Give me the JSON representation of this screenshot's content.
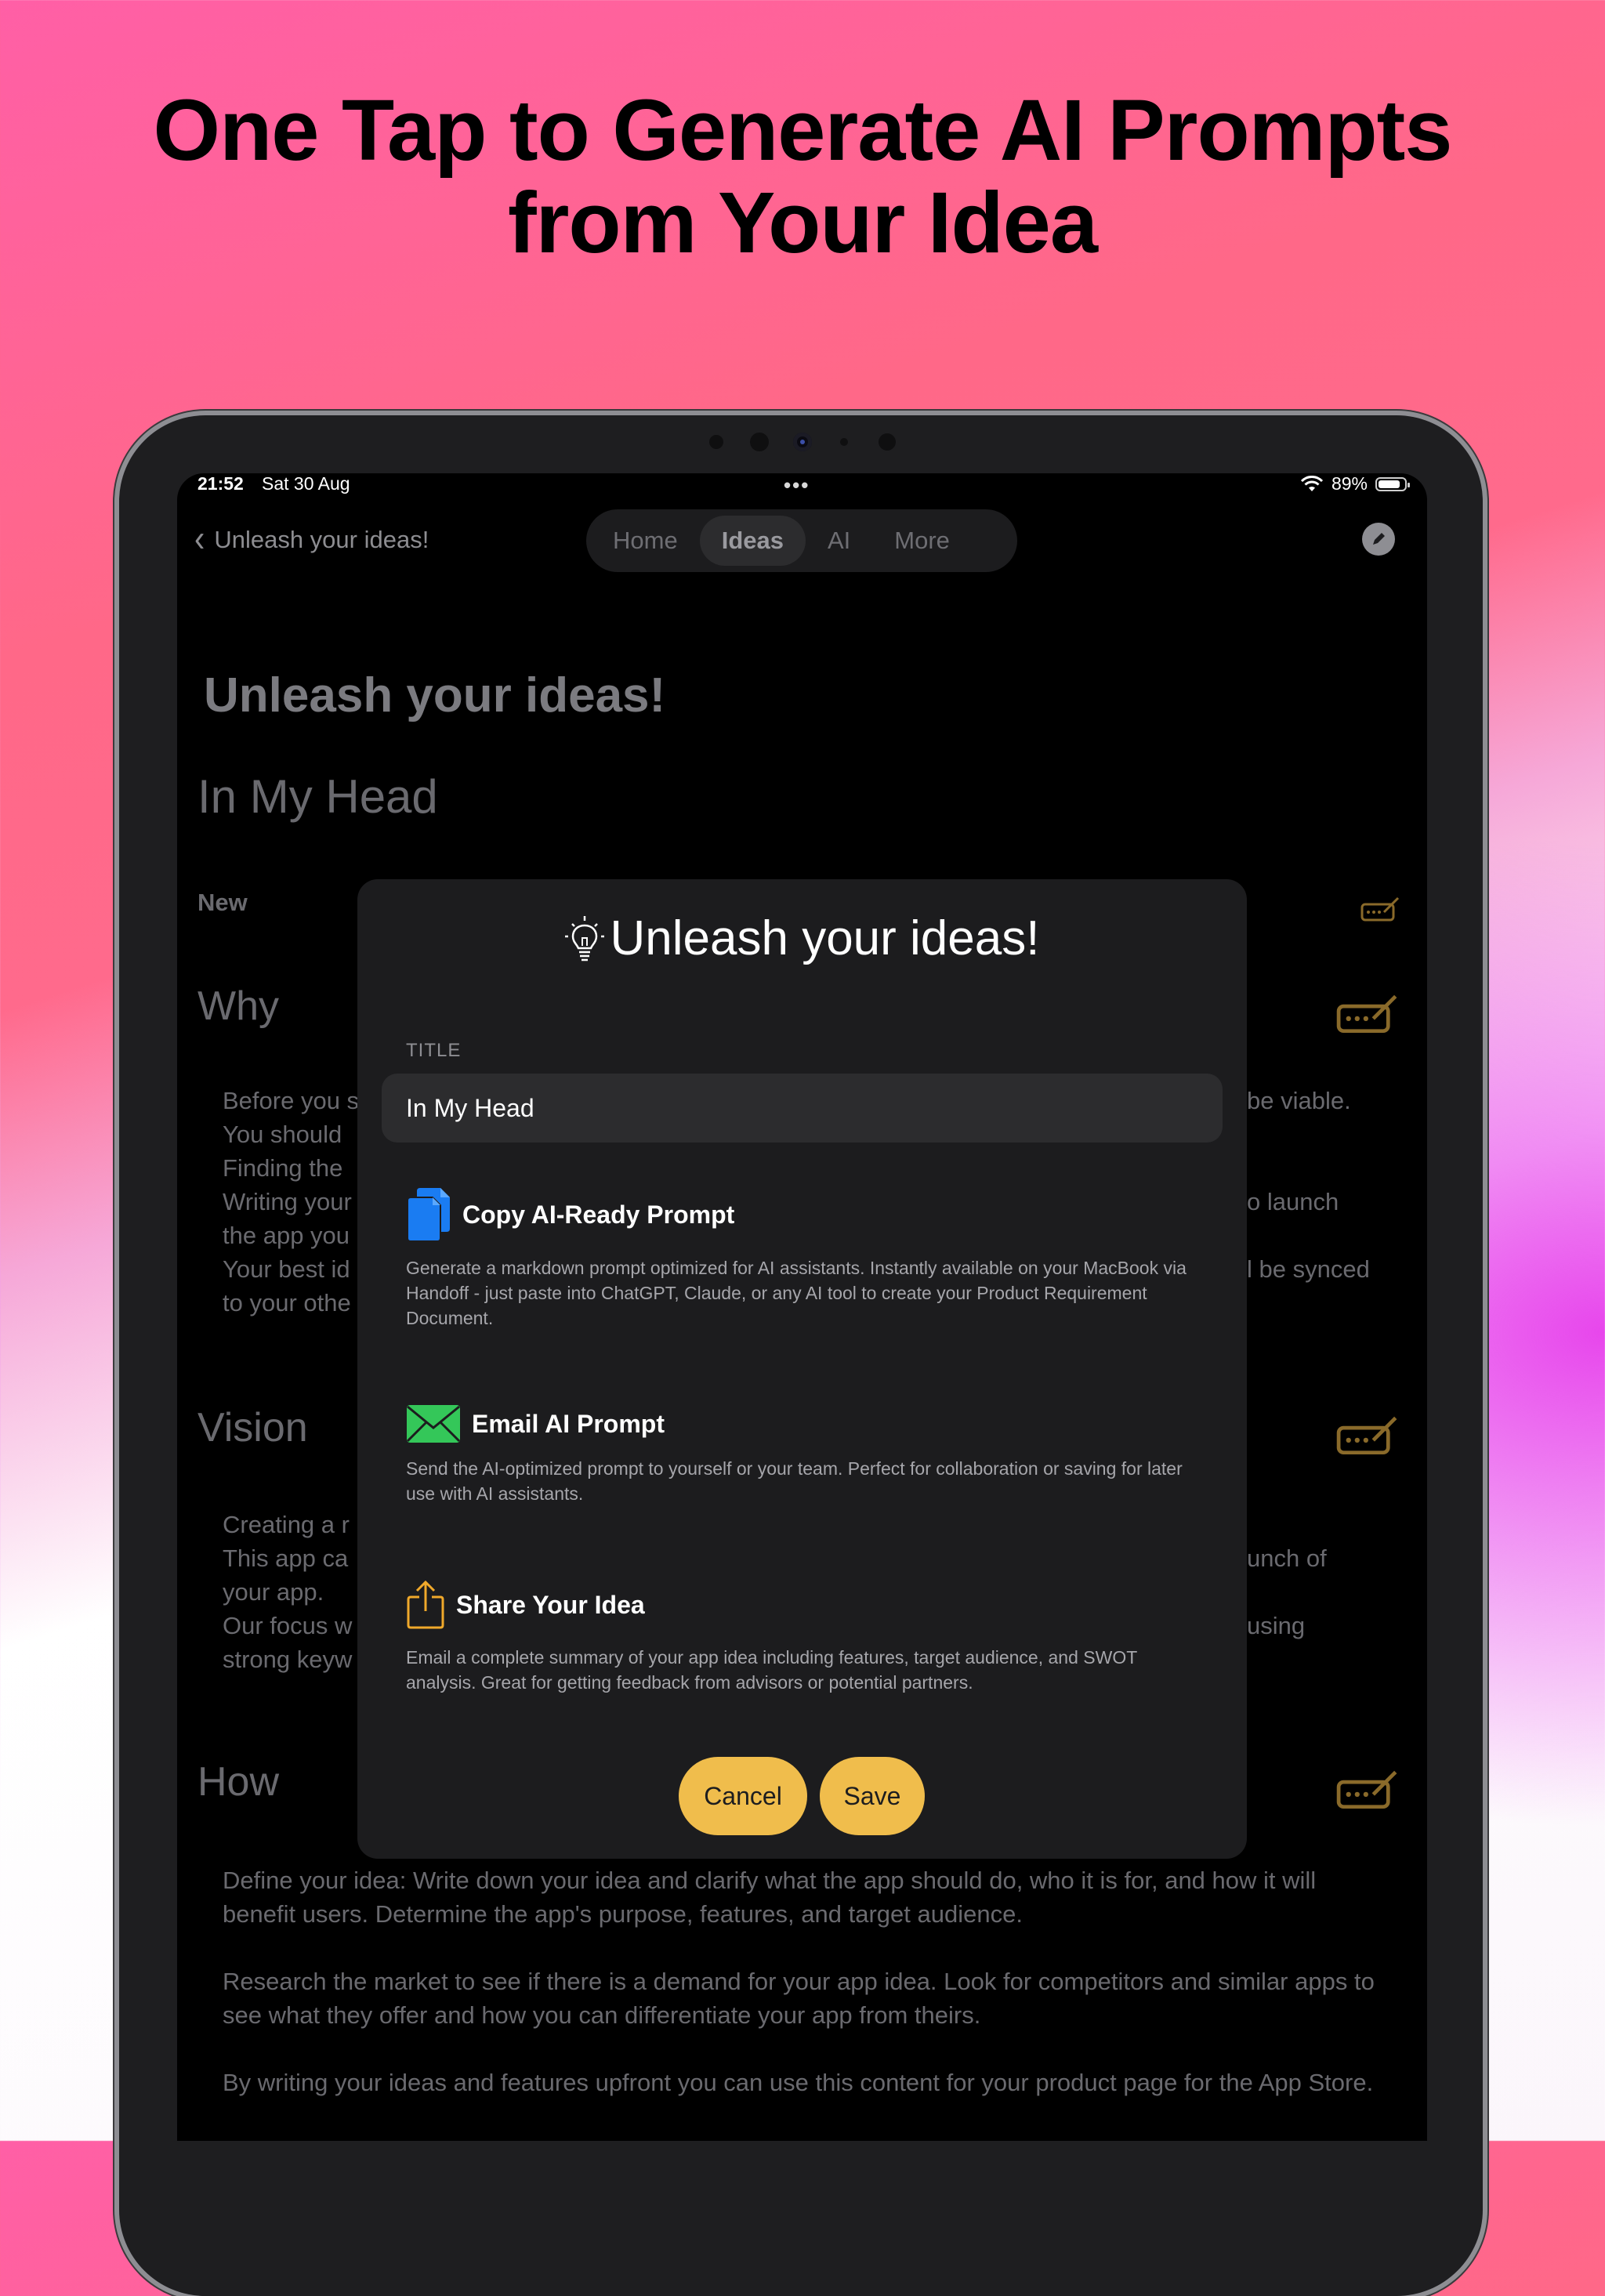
{
  "headline": {
    "line1": "One Tap to Generate AI Prompts",
    "line2": "from Your Idea"
  },
  "status_bar": {
    "time": "21:52",
    "date": "Sat 30 Aug",
    "battery": "89%",
    "battery_level": 0.89
  },
  "nav": {
    "back_label": "Unleash your ideas!",
    "tabs": [
      "Home",
      "Ideas",
      "AI",
      "More"
    ],
    "active_tab": "Ideas"
  },
  "background": {
    "title": "Unleash your ideas!",
    "subtitle": "In My Head",
    "new_label": "New",
    "sections": {
      "why": "Why",
      "vision": "Vision",
      "how": "How"
    },
    "why_fragments": {
      "left": [
        "Before you s",
        "You should",
        "Finding the",
        "Writing your",
        "the app you",
        "Your best id",
        "to your othe"
      ],
      "right_1": "be viable.",
      "right_4": "o launch",
      "right_6": "l be synced"
    },
    "vision_fragments": {
      "left": [
        "Creating a r",
        "This app ca",
        "your app.",
        "Our focus w",
        "strong keyw"
      ],
      "right_2": "unch of",
      "right_4": "using"
    },
    "how_text": {
      "p1": "Define your idea: Write down your idea and clarify what the app should do, who it is for, and how it will benefit users. Determine the app's purpose, features, and target audience.",
      "p2": "Research the market to see if there is a demand for your app idea. Look for competitors and similar apps to see what they offer and how you can differentiate your app from theirs.",
      "p3": "By writing your ideas and features upfront you can use this content for your product page for the App Store."
    }
  },
  "modal": {
    "title": "Unleash your ideas!",
    "field_label": "TITLE",
    "field_value": "In My Head",
    "actions": [
      {
        "icon": "copy-documents-icon",
        "label": "Copy AI-Ready Prompt",
        "description": "Generate a markdown prompt optimized for AI assistants. Instantly available on your MacBook via Handoff - just paste into ChatGPT, Claude, or any AI tool to create your Product Requirement Document."
      },
      {
        "icon": "envelope-icon",
        "label": "Email AI Prompt",
        "description": "Send the AI-optimized prompt to yourself or your team. Perfect for collaboration or saving for later use with AI assistants."
      },
      {
        "icon": "share-icon",
        "label": "Share Your Idea",
        "description": "Email a complete summary of your app idea including features, target audience, and SWOT analysis. Great for getting feedback from advisors or potential partners."
      }
    ],
    "cancel_label": "Cancel",
    "save_label": "Save"
  },
  "colors": {
    "accent": "#f0bd4c",
    "copy_icon": "#1a7cf2",
    "email_icon": "#34c759",
    "share_icon": "#f0a92b",
    "pen_icon": "#8a6a2a"
  }
}
